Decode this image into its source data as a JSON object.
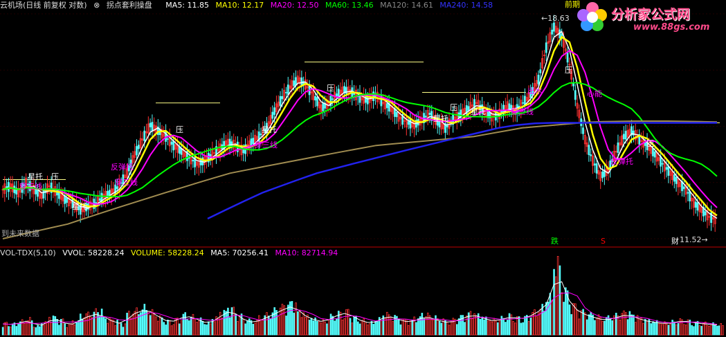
{
  "header": {
    "title": "云机场(日线 前复权 对数)",
    "indicator_name": "拐点套利操盘",
    "ma": [
      {
        "label": "MA5: 11.85",
        "color": "#ffffff"
      },
      {
        "label": "MA10: 12.17",
        "color": "#ffff00"
      },
      {
        "label": "MA20: 12.50",
        "color": "#ff00ff"
      },
      {
        "label": "MA60: 13.46",
        "color": "#00ff00"
      },
      {
        "label": "MA120: 14.61",
        "color": "#888888"
      },
      {
        "label": "MA240: 14.58",
        "color": "#3333ff"
      }
    ],
    "extra_text": "前期"
  },
  "volume_header": {
    "name": "VOL-TDX(5,10)",
    "items": [
      {
        "label": "VVOL: 58228.24",
        "color": "#ffffff"
      },
      {
        "label": "VOLUME: 58228.24",
        "color": "#ffff00"
      },
      {
        "label": "MA5: 70256.41",
        "color": "#ffffff"
      },
      {
        "label": "MA10: 82714.94",
        "color": "#ff00ff"
      }
    ]
  },
  "price_labels": {
    "high": "18.63",
    "low": "11.52",
    "future_note": "到未来数据"
  },
  "signals": [
    {
      "text": "星托",
      "color": "#ffffff"
    },
    {
      "text": "穿三线",
      "color": "#ff00ff"
    },
    {
      "text": "压",
      "color": "#ffffff"
    },
    {
      "text": "星托",
      "color": "#ffffff"
    },
    {
      "text": "反弹托",
      "color": "#ff00ff"
    },
    {
      "text": "穿三线",
      "color": "#ff00ff"
    },
    {
      "text": "压",
      "color": "#ffffff"
    },
    {
      "text": "星托",
      "color": "#ffffff"
    },
    {
      "text": "穿三线",
      "color": "#ff00ff"
    },
    {
      "text": "压",
      "color": "#ffffff"
    },
    {
      "text": "星托",
      "color": "#ffffff"
    },
    {
      "text": "压",
      "color": "#ffffff"
    },
    {
      "text": "星托",
      "color": "#ffffff"
    },
    {
      "text": "穿三线",
      "color": "#ff00ff"
    },
    {
      "text": "出水",
      "color": "#ff00ff"
    },
    {
      "text": "压",
      "color": "#ffffff"
    },
    {
      "text": "心能",
      "color": "#ff00ff"
    },
    {
      "text": "反弹托",
      "color": "#ff00ff"
    },
    {
      "text": "压",
      "color": "#ffffff"
    }
  ],
  "bottom_markers": [
    {
      "text": "跌",
      "color": "#00ff00"
    },
    {
      "text": "S",
      "color": "#ff0000"
    },
    {
      "text": "财",
      "color": "#ffffff"
    }
  ],
  "logo": {
    "brand": "分析家公式网",
    "url": "www.88gs.com"
  },
  "chart_data": {
    "type": "line",
    "title": "云机场(日线 前复权 对数)",
    "ylim": [
      11.0,
      19.0
    ],
    "series": [
      {
        "name": "MA5",
        "color": "#ffffff"
      },
      {
        "name": "MA10",
        "color": "#ffff00"
      },
      {
        "name": "MA20",
        "color": "#ff00ff"
      },
      {
        "name": "MA60",
        "color": "#00ff00"
      },
      {
        "name": "MA120",
        "color": "#a08c50"
      },
      {
        "name": "MA240",
        "color": "#2222ee"
      }
    ],
    "close": [
      12.4,
      12.5,
      12.3,
      12.6,
      12.4,
      12.2,
      12.5,
      12.3,
      12.1,
      12.0,
      11.8,
      11.9,
      12.0,
      12.2,
      12.3,
      12.5,
      12.9,
      13.5,
      14.0,
      14.5,
      14.3,
      14.1,
      13.8,
      13.6,
      13.4,
      13.2,
      13.3,
      13.5,
      13.7,
      13.9,
      13.8,
      13.6,
      13.9,
      14.1,
      14.4,
      15.0,
      15.5,
      15.9,
      16.2,
      16.0,
      15.6,
      15.1,
      15.3,
      15.6,
      15.8,
      15.7,
      15.5,
      15.4,
      15.6,
      15.3,
      15.1,
      14.8,
      14.6,
      14.5,
      14.7,
      14.9,
      14.6,
      14.4,
      14.7,
      14.9,
      15.1,
      15.3,
      15.0,
      14.8,
      14.9,
      15.2,
      15.0,
      15.3,
      15.6,
      16.2,
      17.5,
      18.4,
      18.0,
      16.8,
      15.2,
      14.0,
      13.3,
      12.8,
      13.0,
      13.6,
      14.1,
      14.3,
      14.0,
      13.8,
      13.5,
      13.2,
      12.9,
      12.6,
      12.4,
      12.0,
      11.8,
      11.6,
      11.52
    ],
    "ma120": [
      11.0,
      11.1,
      11.2,
      11.3,
      11.4,
      11.55,
      11.7,
      11.85,
      12.0,
      12.15,
      12.3,
      12.45,
      12.6,
      12.75,
      12.9,
      13.0,
      13.1,
      13.2,
      13.3,
      13.4,
      13.5,
      13.6,
      13.7,
      13.8,
      13.85,
      13.9,
      13.95,
      14.0,
      14.05,
      14.1,
      14.2,
      14.3,
      14.4,
      14.45,
      14.5,
      14.55,
      14.6,
      14.62,
      14.63,
      14.64,
      14.64,
      14.64,
      14.63,
      14.62,
      14.61
    ],
    "ma240": [
      11.55,
      11.8,
      12.05,
      12.3,
      12.5,
      12.7,
      12.9,
      13.05,
      13.2,
      13.35,
      13.5,
      13.65,
      13.8,
      13.95,
      14.1,
      14.25,
      14.4,
      14.5,
      14.56,
      14.58,
      14.58,
      14.58,
      14.58,
      14.58,
      14.58,
      14.58,
      14.58,
      14.58,
      14.58
    ],
    "volume": [
      30,
      28,
      35,
      40,
      22,
      31,
      45,
      38,
      26,
      33,
      48,
      52,
      60,
      41,
      36,
      28,
      55,
      62,
      70,
      58,
      44,
      35,
      40,
      52,
      47,
      39,
      30,
      42,
      58,
      66,
      49,
      37,
      33,
      44,
      51,
      63,
      72,
      80,
      58,
      46,
      39,
      35,
      48,
      56,
      61,
      44,
      37,
      31,
      40,
      52,
      46,
      38,
      35,
      42,
      50,
      44,
      37,
      33,
      39,
      47,
      55,
      49,
      41,
      38,
      43,
      50,
      44,
      46,
      58,
      70,
      95,
      180,
      110,
      75,
      60,
      52,
      46,
      40,
      44,
      50,
      56,
      48,
      40,
      36,
      33,
      30,
      34,
      38,
      36,
      32,
      30,
      28,
      26
    ],
    "volume_ylim": [
      0,
      200
    ]
  }
}
